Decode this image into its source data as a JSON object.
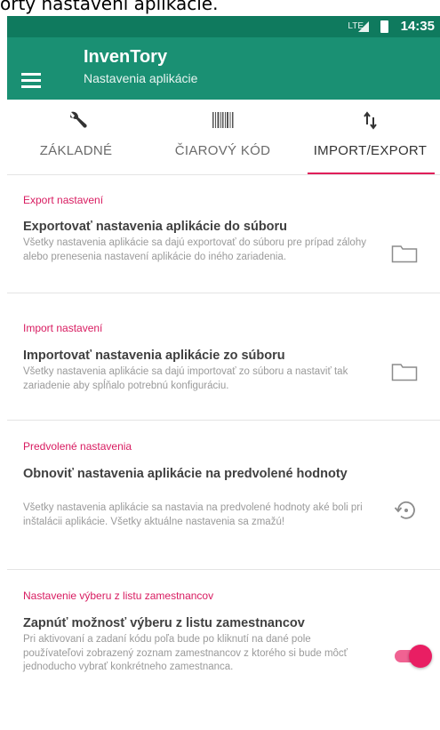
{
  "caption": "orty nastavení aplikácie.",
  "status_bar": {
    "network": "LTE",
    "time": "14:35"
  },
  "app_bar": {
    "title": "InvenTory",
    "subtitle": "Nastavenia aplikácie"
  },
  "tabs": [
    {
      "label": "ZÁKLADNÉ",
      "icon": "wrench-icon",
      "active": false
    },
    {
      "label": "ČIAROVÝ KÓD",
      "icon": "barcode-icon",
      "active": false
    },
    {
      "label": "IMPORT/EXPORT",
      "icon": "import-export-arrows-icon",
      "active": true
    }
  ],
  "sections": [
    {
      "category": "Export nastavení",
      "title": "Exportovať nastavenia aplikácie do súboru",
      "description": "Všetky nastavenia aplikácie sa dajú exportovať do súboru pre prípad zálohy alebo prenesenia nastavení aplikácie do iného zariadenia.",
      "action_icon": "folder-icon"
    },
    {
      "category": "Import nastavení",
      "title": "Importovať nastavenia aplikácie zo súboru",
      "description": "Všetky nastavenia aplikácie sa dajú importovať zo súboru a nastaviť tak zariadenie aby spĺňalo potrebnú konfiguráciu.",
      "action_icon": "folder-icon"
    },
    {
      "category": "Predvolené nastavenia",
      "title": "Obnoviť nastavenia aplikácie na predvolené hodnoty",
      "description": "Všetky nastavenia aplikácie sa nastavia na predvolené hodnoty aké boli pri inštalácii aplikácie. Všetky aktuálne nastavenia sa zmažú!",
      "action_icon": "restore-icon"
    },
    {
      "category": "Nastavenie výberu z listu zamestnancov",
      "title": "Zapnúť možnosť výberu z listu zamestnancov",
      "description": "Pri aktivovaní a zadaní kódu poľa bude po kliknutí na dané pole používateľovi zobrazený zoznam zamestnancov z ktorého si bude môcť jednoducho vybrať konkrétneho zamestnanca.",
      "action_icon": "toggle-switch",
      "toggle_on": true
    }
  ],
  "colors": {
    "status_bar": "#0f7a5e",
    "app_bar": "#1a9073",
    "accent": "#d81b60",
    "toggle_thumb": "#e91e63",
    "toggle_track": "#f06292"
  }
}
